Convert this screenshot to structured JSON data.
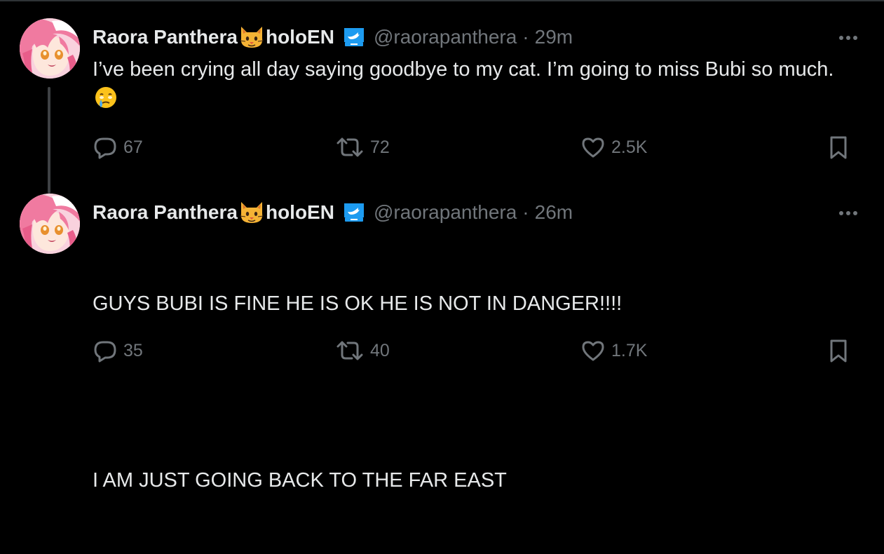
{
  "colors": {
    "background": "#000000",
    "text_primary": "#e7e9ea",
    "text_secondary": "#71767b",
    "verified_badge": "#1d9bf0",
    "thread_line": "#3e4144"
  },
  "tweets": [
    {
      "author": {
        "display_name": "Raora Panthera",
        "name_emoji": "cat-face-emoji",
        "name_suffix": "holoEN",
        "badge": "verified-badge-icon",
        "handle": "@raorapanthera"
      },
      "separator": "·",
      "time": "29m",
      "text": "I’ve been crying all day saying goodbye to my cat. I’m going to miss Bubi so much.",
      "text_emoji": "face-holding-back-tears-emoji",
      "stats": {
        "replies": "67",
        "retweets": "72",
        "likes": "2.5K"
      }
    },
    {
      "author": {
        "display_name": "Raora Panthera",
        "name_emoji": "cat-face-emoji",
        "name_suffix": "holoEN",
        "badge": "verified-badge-icon",
        "handle": "@raorapanthera"
      },
      "separator": "·",
      "time": "26m",
      "text_lines": [
        "GUYS BUBI IS FINE HE IS OK HE IS NOT IN DANGER!!!!",
        "",
        "I AM JUST GOING BACK TO THE FAR EAST"
      ],
      "stats": {
        "replies": "35",
        "retweets": "40",
        "likes": "1.7K"
      }
    }
  ]
}
